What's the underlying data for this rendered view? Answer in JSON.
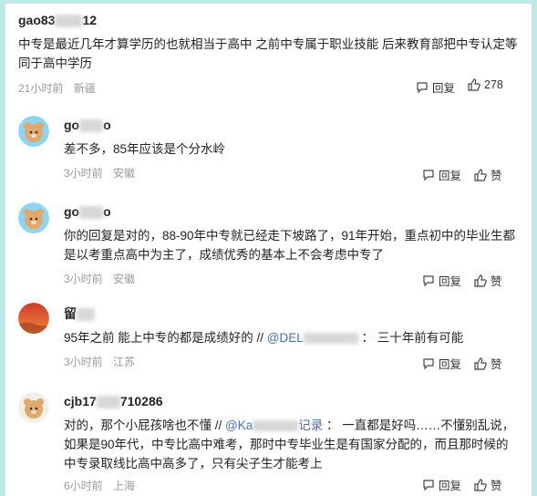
{
  "comments": [
    {
      "user_prefix": "gao83",
      "user_suffix": "12",
      "text": "中专是最近几年才算学历的也就相当于高中 之前中专属于职业技能 后来教育部把中专认定等同于高中学历",
      "time": "21小时前",
      "location": "新疆",
      "reply_label": "回复",
      "likes": "278"
    }
  ],
  "replies": [
    {
      "user_prefix": "go",
      "user_suffix": "o",
      "text": "差不多，85年应该是个分水岭",
      "time": "3小时前",
      "location": "安徽",
      "reply_label": "回复",
      "like_label": "赞"
    },
    {
      "user_prefix": "go",
      "user_suffix": "o",
      "text": "你的回复是对的，88-90年中专就已经走下坡路了，91年开始，重点初中的毕业生都是以考重点高中为主了，成绩优秀的基本上不会考虑中专了",
      "time": "3小时前",
      "location": "安徽",
      "reply_label": "回复",
      "like_label": "赞"
    },
    {
      "user_prefix": "留",
      "user_suffix": "",
      "text_before": "95年之前 能上中专的都是成绩好的 //",
      "mention": "@DEL",
      "text_after": "：  三十年前有可能",
      "time": "3小时前",
      "location": "江苏",
      "reply_label": "回复",
      "like_label": "赞"
    },
    {
      "user_prefix": "cjb17",
      "user_suffix": "710286",
      "text_before": "对的，那个小屁孩啥也不懂 //",
      "mention": "@Ka",
      "mention_suffix": "记录",
      "text_after": "：  一直都是好吗……不懂别乱说，如果是90年代，中专比高中难考，那时中专毕业生是有国家分配的，而且那时候的中专录取线比高中高多了，只有尖子生才能考上",
      "time": "6小时前",
      "location": "上海",
      "reply_label": "回复",
      "like_label": "赞"
    }
  ],
  "colors": {
    "border": "#bfe9e6",
    "meta": "#9a9a9a",
    "link": "#4a6fa5"
  },
  "icons": [
    "reply-icon",
    "like-icon"
  ]
}
